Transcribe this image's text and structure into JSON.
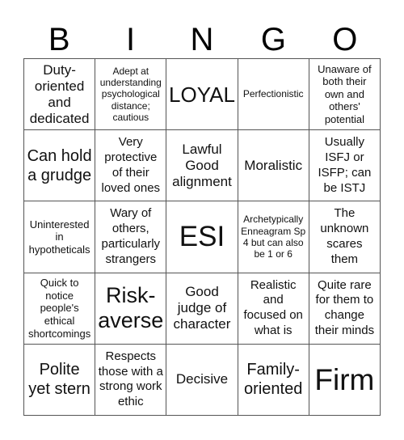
{
  "card": {
    "header": [
      "B",
      "I",
      "N",
      "G",
      "O"
    ],
    "rows": [
      [
        "Duty-oriented and dedicated",
        "Adept at understanding psychological distance; cautious",
        "LOYAL",
        "Perfectionistic",
        "Unaware of both their own and others' potential"
      ],
      [
        "Can hold a grudge",
        "Very protective of their loved ones",
        "Lawful Good alignment",
        "Moralistic",
        "Usually ISFJ or ISFP; can be ISTJ"
      ],
      [
        "Uninterested in hypotheticals",
        "Wary of others, particularly strangers",
        "ESI",
        "Archetypically Enneagram Sp 4 but can also be 1 or 6",
        "The unknown scares them"
      ],
      [
        "Quick to notice people's ethical shortcomings",
        "Risk-averse",
        "Good judge of character",
        "Realistic and focused on what is",
        "Quite rare for them to change their minds"
      ],
      [
        "Polite yet stern",
        "Respects those with a strong work ethic",
        "Decisive",
        "Family-oriented",
        "Firm"
      ]
    ]
  }
}
